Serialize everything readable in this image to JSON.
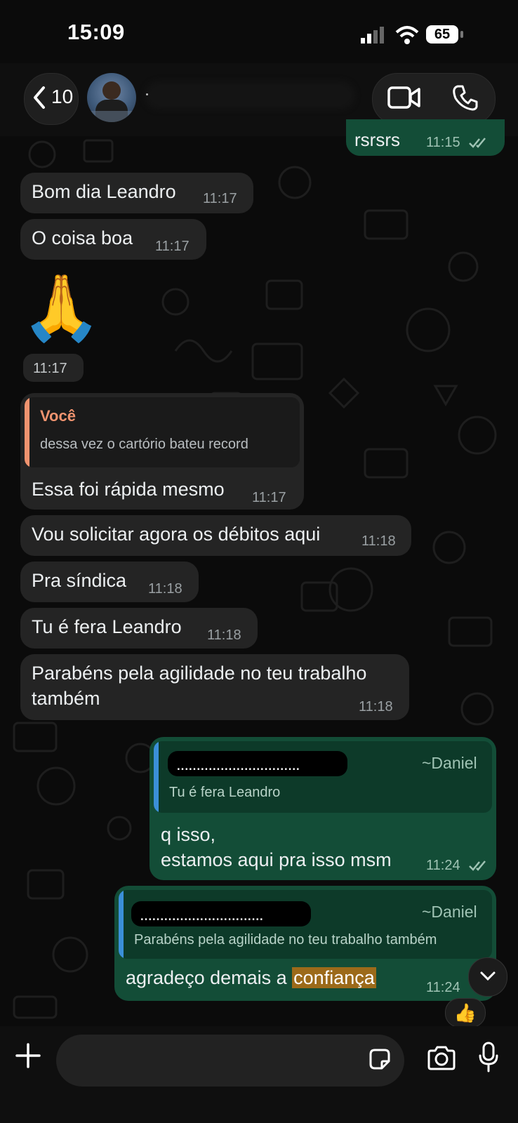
{
  "status_bar": {
    "time": "15:09",
    "battery": "65"
  },
  "header": {
    "back_count": "10"
  },
  "messages": {
    "top_partial": {
      "text": "rsrsrs",
      "time": "11:15"
    },
    "m1": {
      "text": "Bom dia Leandro",
      "time": "11:17"
    },
    "m2": {
      "text": "O coisa boa",
      "time": "11:17"
    },
    "m3": {
      "emoji": "🙏",
      "time": "11:17"
    },
    "m4": {
      "quote_author": "Você",
      "quote_text": "dessa vez o cartório bateu record",
      "text": "Essa foi rápida mesmo",
      "time": "11:17"
    },
    "m5": {
      "text": "Vou solicitar agora os débitos aqui",
      "time": "11:18"
    },
    "m6": {
      "text": "Pra síndica",
      "time": "11:18"
    },
    "m7": {
      "text": "Tu é fera Leandro",
      "time": "11:18"
    },
    "m8": {
      "line1": "Parabéns pela agilidade no teu trabalho",
      "line2": "também",
      "time": "11:18"
    },
    "m9": {
      "quote_redacted": "...............................",
      "quote_author": "~Daniel",
      "quote_text": "Tu é fera Leandro",
      "line1": "q isso,",
      "line2": "estamos aqui pra isso msm",
      "time": "11:24"
    },
    "m10": {
      "quote_redacted": "...............................",
      "quote_author": "~Daniel",
      "quote_text": "Parabéns pela agilidade no teu trabalho também",
      "text_before": "agradeço demais a ",
      "text_highlight": "confiança",
      "time": "11:24",
      "reaction": "👍"
    }
  },
  "colors": {
    "incoming": "#242424",
    "outgoing": "#134d37",
    "you_accent": "#f0936f",
    "daniel_accent": "#3b8fd8"
  },
  "icons": [
    "back-chevron-icon",
    "video-call-icon",
    "phone-icon",
    "plus-icon",
    "sticker-icon",
    "camera-icon",
    "microphone-icon",
    "chevron-down-icon"
  ]
}
